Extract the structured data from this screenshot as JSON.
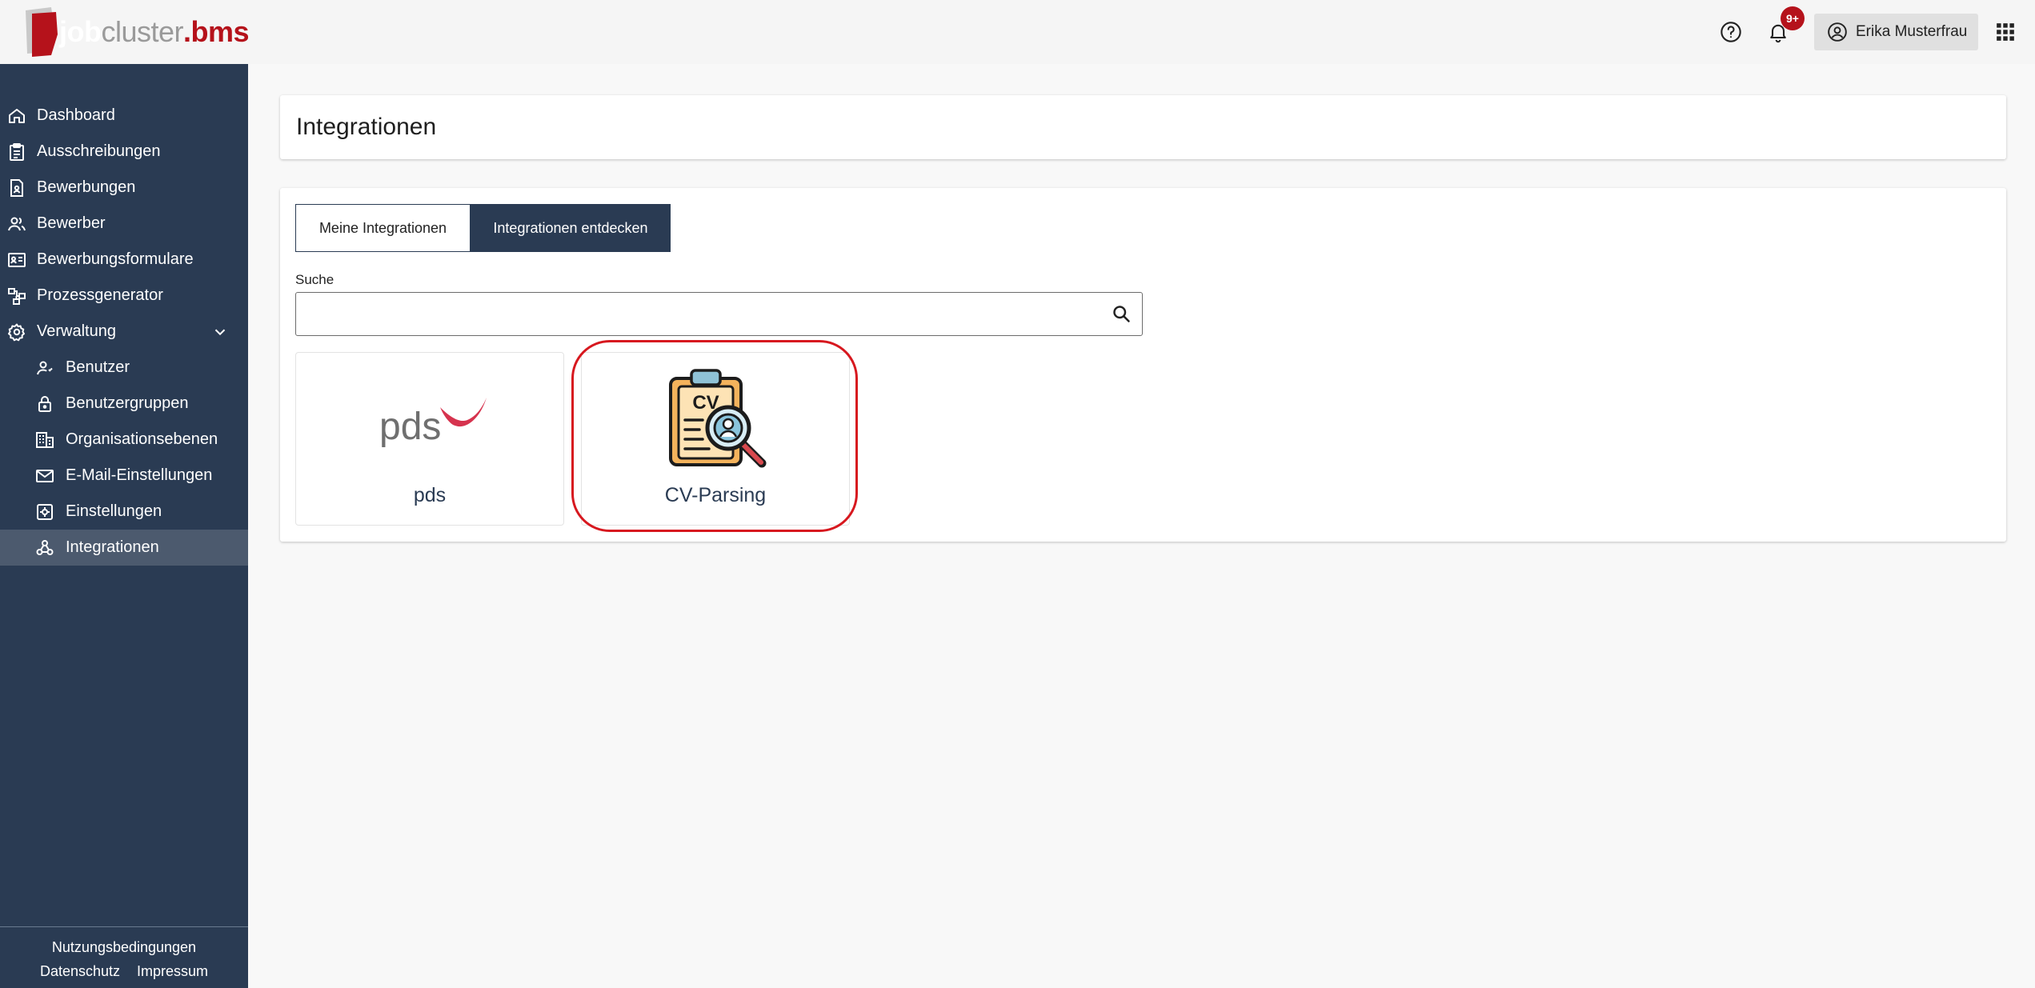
{
  "app": {
    "logo": {
      "part1": "job",
      "part2": "cluster",
      "part3": ".bms"
    },
    "header": {
      "help_icon": "help-circle-icon",
      "notifications_badge": "9+",
      "user_name": "Erika Musterfrau",
      "apps_icon": "grid-icon"
    },
    "colors": {
      "sidebar": "#2a3b53",
      "accent": "#b5121b",
      "active_item": "#4c5a6e",
      "highlight": "#d7181f"
    }
  },
  "sidebar": {
    "items": [
      {
        "label": "Dashboard",
        "icon": "home-icon"
      },
      {
        "label": "Ausschreibungen",
        "icon": "clipboard-icon"
      },
      {
        "label": "Bewerbungen",
        "icon": "document-user-icon"
      },
      {
        "label": "Bewerber",
        "icon": "users-icon"
      },
      {
        "label": "Bewerbungsformulare",
        "icon": "id-card-icon"
      },
      {
        "label": "Prozessgenerator",
        "icon": "flow-icon"
      },
      {
        "label": "Verwaltung",
        "icon": "gear-icon",
        "expanded": true
      }
    ],
    "subitems": [
      {
        "label": "Benutzer",
        "icon": "user-icon"
      },
      {
        "label": "Benutzergruppen",
        "icon": "lock-icon"
      },
      {
        "label": "Organisationsebenen",
        "icon": "building-icon"
      },
      {
        "label": "E-Mail-Einstellungen",
        "icon": "mail-icon"
      },
      {
        "label": "Einstellungen",
        "icon": "settings-icon"
      },
      {
        "label": "Integrationen",
        "icon": "webhook-icon",
        "active": true
      }
    ],
    "footer": {
      "terms": "Nutzungsbedingungen",
      "privacy": "Datenschutz",
      "imprint": "Impressum"
    }
  },
  "main": {
    "title": "Integrationen",
    "tabs": [
      {
        "label": "Meine Integrationen",
        "active": false
      },
      {
        "label": "Integrationen entdecken",
        "active": true
      }
    ],
    "search": {
      "label": "Suche",
      "value": "",
      "placeholder": ""
    },
    "integrations": [
      {
        "name": "pds",
        "logo_text": "pds"
      },
      {
        "name": "CV-Parsing",
        "logo_text": "CV"
      }
    ]
  }
}
